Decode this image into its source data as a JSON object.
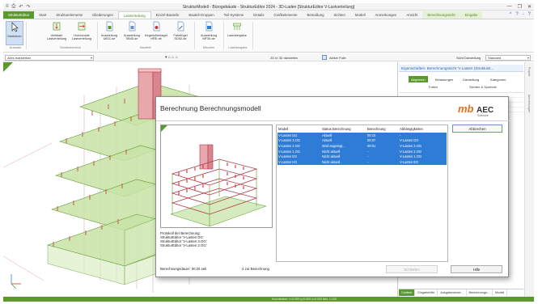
{
  "titlebar": {
    "quick_access": [
      "≡",
      "⎙",
      "↶",
      "↷"
    ],
    "title": "StrukturModell - Bürogebäude - StrukturEditor 2024 - 3D-Laden [StrukturEditor V-Lastverteilung]",
    "controls": [
      "—",
      "❐",
      "✕"
    ]
  },
  "menubar": {
    "file_tab": "StrukturEditor",
    "tabs": [
      "Start",
      "Strukturelemente",
      "Gliederungen",
      "Lastverteilung",
      "Einzel-Bauteile",
      "Bauteil-Gruppen",
      "Teil-Systeme",
      "Details",
      "Grafikelemente",
      "Bemaßung",
      "Sichten",
      "Modell",
      "Anmerkungen",
      "Ansicht",
      "Berechnungssicht",
      "Eingabe"
    ],
    "active_tab": "Lastverteilung",
    "right_icons": [
      "^",
      "?",
      "-",
      "?"
    ]
  },
  "ribbon": {
    "buttons": [
      {
        "label": "Markieren"
      },
      {
        "label": "Vertikale Lastverteilung"
      },
      {
        "label": "Horizontale Lastverteilung"
      },
      {
        "label": "Ausstellung UB11.de"
      },
      {
        "label": "Ausstellung SB45.de"
      },
      {
        "label": "Kegelrollierlager HRE.de"
      },
      {
        "label": "Fahrflügel SD52.de"
      },
      {
        "label": "Ausstellung MF30.de"
      },
      {
        "label": "Lastübergabe"
      }
    ],
    "groups": [
      "Auswahl",
      "Strukturbereich",
      "Bauteile",
      "Mischen",
      "Lastübergabe"
    ]
  },
  "toolbar": {
    "filter_value": "Alles markierbar",
    "view_label": "2D in 3D darstellen",
    "active_label": "Aktive Folie",
    "display_label": "Sicht Darstellung",
    "display_value": "Standard"
  },
  "properties": {
    "header": "Eigenschaften: Berechnungssicht 'V-Lasten (StrukturE...",
    "tabs": [
      "Allgemein",
      "Belastungen",
      "Darstellung",
      "Kategorien"
    ],
    "subtabs": [
      "Folien",
      "Sichten & Symbole"
    ],
    "bottom_tabs": [
      "Content",
      "Eingabehilfe",
      "Ausgabeverwe...",
      "Berechnungs...",
      "Modell"
    ],
    "side_tabs": [
      "Projekt",
      "Anmerkungen"
    ]
  },
  "statusbar": {
    "text": "Koordinaten: x=0.000  y=0.000  z=0.000  Mst. 1:100"
  },
  "dialog": {
    "title": "Berechnung Berechnungsmodell",
    "logo_main": "mb",
    "logo_brand": "AEC",
    "logo_sub": "Software",
    "columns": [
      "Modell",
      "Status Berechnung",
      "Berechnung",
      "Abhängigkeiten"
    ],
    "rows": [
      {
        "model": "V-Lasten DG",
        "status": "Aktuell",
        "calc": "00:10",
        "deps": "-"
      },
      {
        "model": "V-Lasten 3.OG",
        "status": "Aktuell",
        "calc": "00:07",
        "deps": "V-Lasten DG"
      },
      {
        "model": "V-Lasten 2.OG",
        "status": "Wird angelegt...",
        "calc": "00:01",
        "deps": "V-Lasten 3.OG"
      },
      {
        "model": "V-Lasten 1.OG",
        "status": "Nicht aktuell",
        "calc": "-",
        "deps": "V-Lasten 2.OG"
      },
      {
        "model": "V-Lasten EG",
        "status": "Nicht aktuell",
        "calc": "-",
        "deps": "V-Lasten 1.OG"
      },
      {
        "model": "V-Lasten KG",
        "status": "Nicht aktuell",
        "calc": "-",
        "deps": "V-Lasten EG"
      }
    ],
    "protocol_lines": [
      "Protokoll der Berechnung:",
      "StrukturEditor 'V-Lasten DG'",
      "StrukturEditor 'V-Lasten 3.OG'",
      "StrukturEditor 'V-Lasten 2.OG'"
    ],
    "duration_label": "Berechnungsdauer: 00:20 sek",
    "queue_label": "4 zur Berechnung",
    "cancel_button": "Abbrechen",
    "close_button": "Schließen",
    "help_button": "Hilfe"
  }
}
